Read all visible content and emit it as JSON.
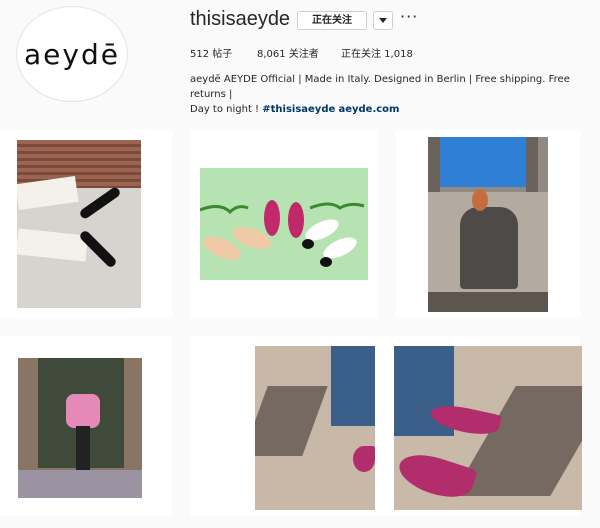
{
  "profile": {
    "avatar_text": "aeydē",
    "username": "thisisaeyde",
    "follow_button_label": "正在关注",
    "stats": {
      "posts": "512 帖子",
      "followers": "8,061 关注者",
      "following": "正在关注 1,018"
    },
    "bio": {
      "line1": "aeydē AEYDE Official | Made in Italy. Designed in Berlin | Free shipping. Free returns |",
      "line2_prefix": "Day to night ! ",
      "hashtag": "#thisisaeyde",
      "website": "aeyde.com"
    }
  },
  "icons": {
    "dropdown": "chevron-down-icon",
    "more": "more-options-icon"
  },
  "posts": [
    {
      "id": "post-1",
      "subject": "black slingback shoes on windowsill"
    },
    {
      "id": "post-2",
      "subject": "shoe flatlay on green background"
    },
    {
      "id": "post-3",
      "subject": "woman in grey suit sitting"
    },
    {
      "id": "post-4",
      "subject": "woman in pink top"
    },
    {
      "id": "post-5",
      "subject": "pink satin mule left"
    },
    {
      "id": "post-6",
      "subject": "pink satin mule right"
    }
  ],
  "colors": {
    "background": "#fafafa",
    "link": "#003569",
    "text": "#262626",
    "border": "#dbdbdb"
  }
}
